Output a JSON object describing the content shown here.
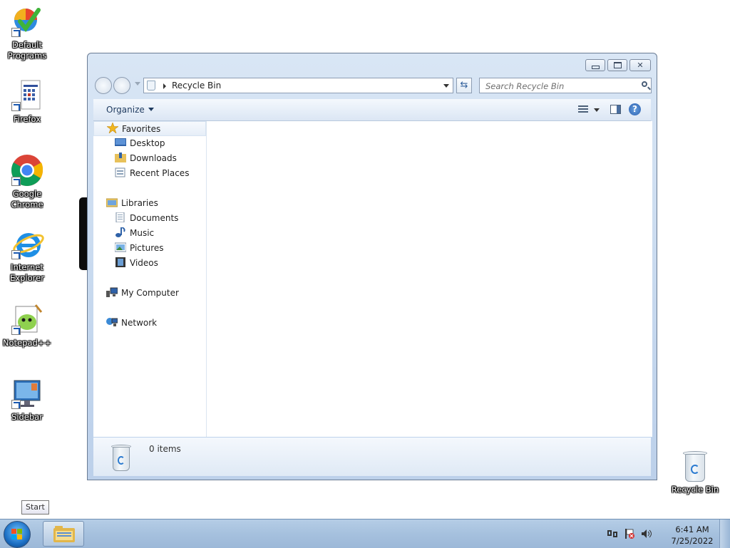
{
  "desktop": {
    "icons": [
      {
        "label": "Default Programs",
        "icon": "default-programs-icon"
      },
      {
        "label": "Firefox",
        "icon": "firefox-icon"
      },
      {
        "label": "Google Chrome",
        "icon": "chrome-icon"
      },
      {
        "label": "Internet Explorer",
        "icon": "internet-explorer-icon"
      },
      {
        "label": "Notepad++",
        "icon": "notepad-plus-plus-icon"
      },
      {
        "label": "Sidebar",
        "icon": "sidebar-icon"
      }
    ],
    "recycle_bin_label": "Recycle Bin"
  },
  "window": {
    "address": {
      "location": "Recycle Bin"
    },
    "search": {
      "placeholder": "Search Recycle Bin"
    },
    "toolbar": {
      "organize_label": "Organize"
    },
    "nav": {
      "favorites": {
        "label": "Favorites",
        "items": [
          "Desktop",
          "Downloads",
          "Recent Places"
        ]
      },
      "libraries": {
        "label": "Libraries",
        "items": [
          "Documents",
          "Music",
          "Pictures",
          "Videos"
        ]
      },
      "computer_label": "My Computer",
      "network_label": "Network"
    },
    "details": {
      "item_count": "0 items"
    }
  },
  "tooltip": {
    "text": "Start"
  },
  "taskbar": {
    "clock": {
      "time": "6:41 AM",
      "date": "7/25/2022"
    }
  }
}
